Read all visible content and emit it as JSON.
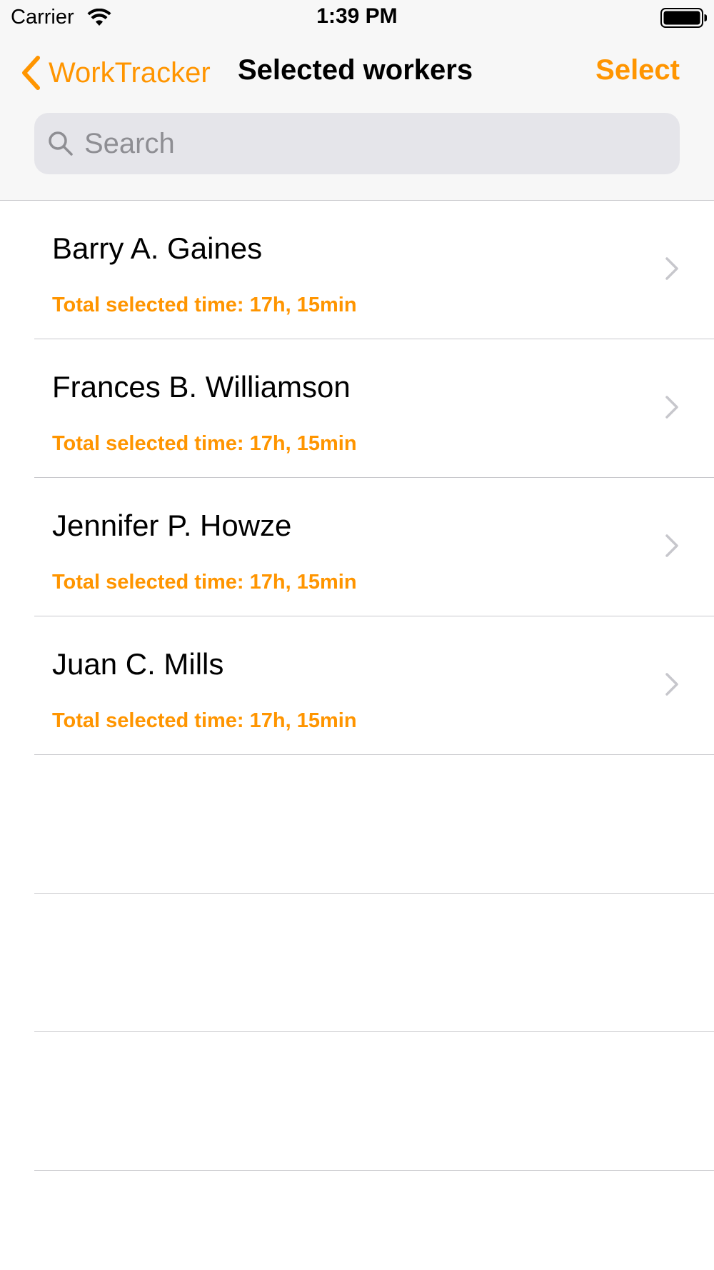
{
  "status_bar": {
    "carrier": "Carrier",
    "time": "1:39 PM",
    "icons": [
      "wifi-icon",
      "battery-icon"
    ]
  },
  "nav": {
    "back_label": "WorkTracker",
    "back_icon": "chevron-left-icon",
    "title": "Selected workers",
    "select_label": "Select"
  },
  "search": {
    "placeholder": "Search",
    "value": "",
    "icon": "search-icon"
  },
  "workers": [
    {
      "name": "Barry A. Gaines",
      "detail": "Total selected time: 17h, 15min"
    },
    {
      "name": "Frances B. Williamson",
      "detail": "Total selected time: 17h, 15min"
    },
    {
      "name": "Jennifer P. Howze",
      "detail": "Total selected time: 17h, 15min"
    },
    {
      "name": "Juan C. Mills",
      "detail": "Total selected time: 17h, 15min"
    }
  ],
  "colors": {
    "accent": "#ff9500",
    "separator": "#c8c8cc",
    "search_bg": "#e5e5ea",
    "placeholder": "#8e8e93",
    "chrome_bg": "#f7f7f7"
  }
}
